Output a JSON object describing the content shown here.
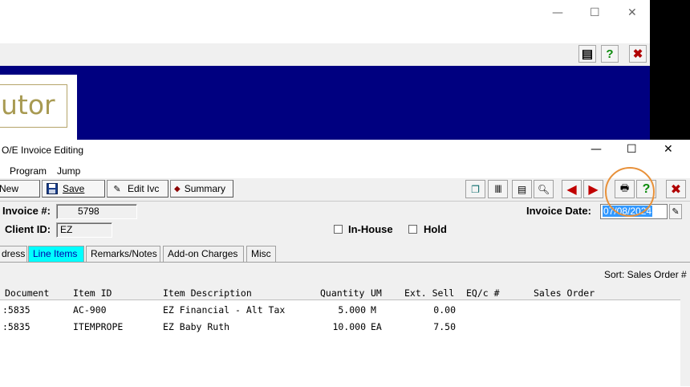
{
  "background_window": {
    "logo_text": "utor",
    "caption_buttons": [
      "—",
      "☐",
      "✕"
    ]
  },
  "front_window": {
    "title": "O/E Invoice Editing",
    "caption_buttons": [
      "—",
      "☐",
      "✕"
    ],
    "menu": [
      "Program",
      "Jump"
    ],
    "toolbar": {
      "new_label": "New",
      "save_label": "Save",
      "edit_ivc_label": "Edit Ivc",
      "summary_label": "Summary"
    },
    "header": {
      "invoice_label": "Invoice #:",
      "invoice_value": "5798",
      "client_label": "Client ID:",
      "client_value": "EZ",
      "inhouse_label": "In-House",
      "hold_label": "Hold",
      "invoice_date_label": "Invoice Date:",
      "invoice_date_value": "07/08/2024"
    },
    "tabs": [
      "dress",
      "Line Items",
      "Remarks/Notes",
      "Add-on Charges",
      "Misc"
    ],
    "active_tab": "Line Items",
    "sort_label": "Sort: Sales Order #",
    "grid": {
      "columns": [
        "Document",
        "Item ID",
        "Item Description",
        "Quantity",
        "UM",
        "Ext. Sell",
        "EQ/c #",
        "Sales Order"
      ],
      "rows": [
        {
          "document": ":5835",
          "item_id": "AC-900",
          "description": "EZ Financial - Alt Tax",
          "quantity": "5.000",
          "um": "M",
          "ext_sell": "0.00"
        },
        {
          "document": ":5835",
          "item_id": "ITEMPROPE",
          "description": "EZ Baby Ruth",
          "quantity": "10.000",
          "um": "EA",
          "ext_sell": "7.50"
        }
      ]
    }
  },
  "colors": {
    "navy": "#000080",
    "active_tab": "#00ffff",
    "highlight_circle": "#e8913a",
    "selection": "#3399ff"
  }
}
